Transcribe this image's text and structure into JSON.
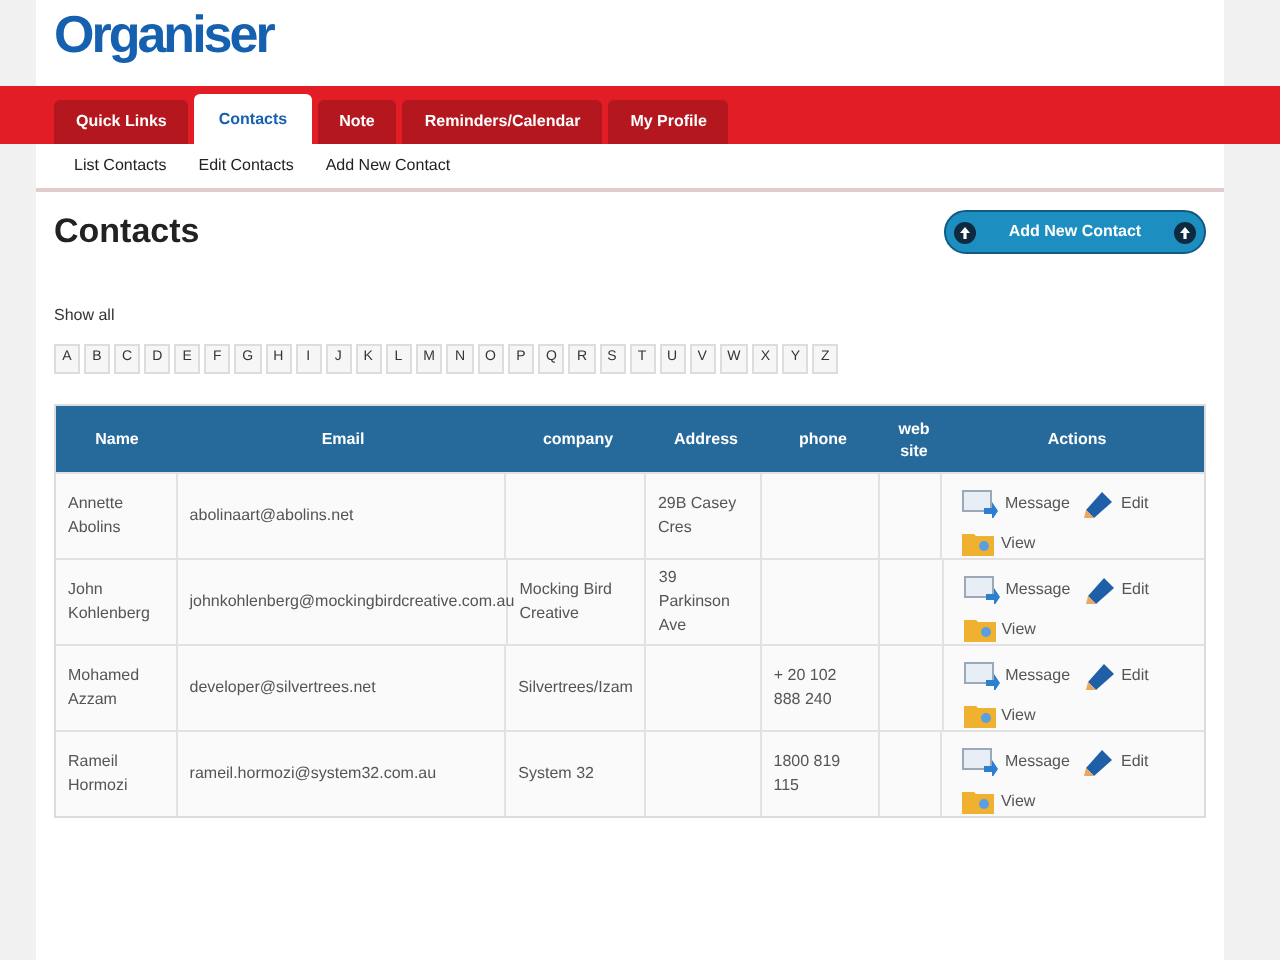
{
  "logo": "Organiser",
  "tabs": [
    {
      "label": "Quick Links",
      "selected": false
    },
    {
      "label": "Contacts",
      "selected": true
    },
    {
      "label": "Note",
      "selected": false
    },
    {
      "label": "Reminders/Calendar",
      "selected": false
    },
    {
      "label": "My Profile",
      "selected": false
    }
  ],
  "subnav": [
    "List Contacts",
    "Edit Contacts",
    "Add New Contact"
  ],
  "heading": "Contacts",
  "add_button": "Add New Contact",
  "show_all": "Show all",
  "letters": [
    "A",
    "B",
    "C",
    "D",
    "E",
    "F",
    "G",
    "H",
    "I",
    "J",
    "K",
    "L",
    "M",
    "N",
    "O",
    "P",
    "Q",
    "R",
    "S",
    "T",
    "U",
    "V",
    "W",
    "X",
    "Y",
    "Z"
  ],
  "table": {
    "columns": [
      "Name",
      "Email",
      "company",
      "Address",
      "phone",
      "web site",
      "Actions"
    ],
    "rows": [
      {
        "name": "Annette Abolins",
        "email": "abolinaart@abolins.net",
        "company": "",
        "address": "29B Casey Cres",
        "phone": "",
        "actions": [
          "Message",
          "Edit",
          "View"
        ]
      },
      {
        "name": "John Kohlenberg",
        "email": "johnkohlenberg@mockingbirdcreative.com.au",
        "company": "Mocking Bird Creative",
        "address": "39 Parkinson Ave",
        "phone": "",
        "actions": [
          "Message",
          "Edit",
          "View"
        ]
      },
      {
        "name": "Mohamed Azzam",
        "email": "developer@silvertrees.net",
        "company": "Silvertrees/Izam",
        "address": "",
        "phone": "+ 20 102 888 240",
        "actions": [
          "Message",
          "Edit",
          "View"
        ]
      },
      {
        "name": "Rameil Hormozi",
        "email": "rameil.hormozi@system32.com.au",
        "company": "System 32",
        "address": "",
        "phone": "1800 819 115",
        "actions": [
          "Message",
          "Edit",
          "View"
        ]
      }
    ]
  }
}
